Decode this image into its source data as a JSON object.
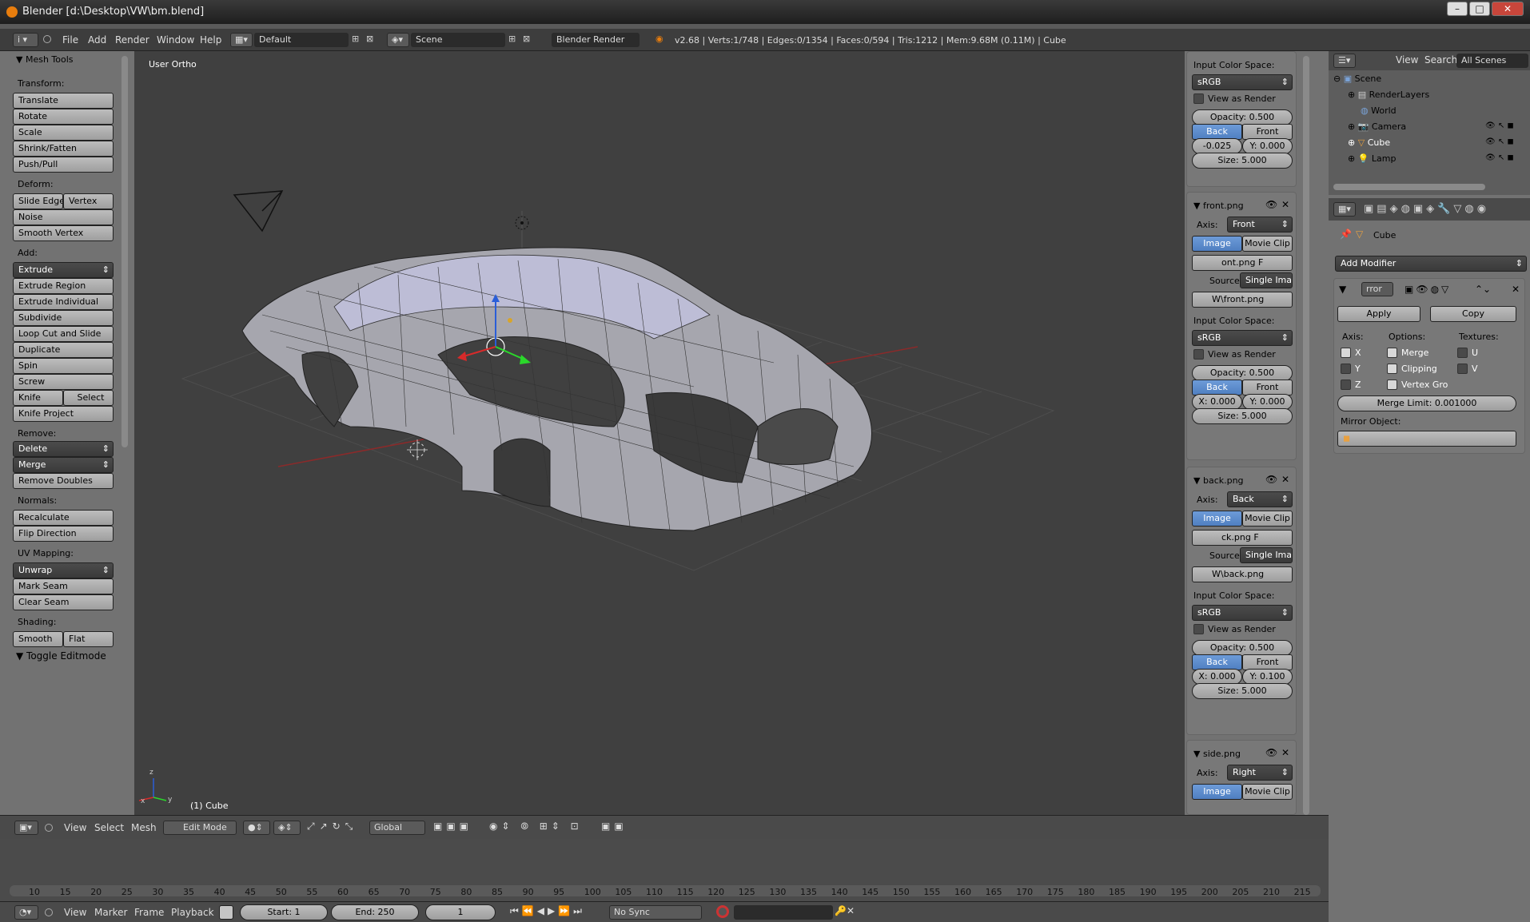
{
  "titlebar": {
    "title": "Blender [d:\\Desktop\\VW\\bm.blend]"
  },
  "infobar": {
    "menus": [
      "File",
      "Add",
      "Render",
      "Window",
      "Help"
    ],
    "layout": "Default",
    "scene": "Scene",
    "engine": "Blender Render",
    "stats": "v2.68 | Verts:1/748 | Edges:0/1354 | Faces:0/594 | Tris:1212 | Mem:9.68M (0.11M) | Cube"
  },
  "left": {
    "title": "Mesh Tools",
    "transform": {
      "label": "Transform:",
      "items": [
        "Translate",
        "Rotate",
        "Scale",
        "Shrink/Fatten",
        "Push/Pull"
      ]
    },
    "deform": {
      "label": "Deform:",
      "slide_edge": "Slide Edge",
      "vertex": "Vertex",
      "noise": "Noise",
      "smooth_vertex": "Smooth Vertex"
    },
    "add": {
      "label": "Add:",
      "extrude": "Extrude",
      "items": [
        "Extrude Region",
        "Extrude Individual",
        "Subdivide",
        "Loop Cut and Slide",
        "Duplicate",
        "Spin",
        "Screw"
      ],
      "knife": "Knife",
      "select": "Select",
      "knife_project": "Knife Project"
    },
    "remove": {
      "label": "Remove:",
      "delete": "Delete",
      "merge": "Merge",
      "remove_doubles": "Remove Doubles"
    },
    "normals": {
      "label": "Normals:",
      "recalculate": "Recalculate",
      "flip": "Flip Direction"
    },
    "uv": {
      "label": "UV Mapping:",
      "unwrap": "Unwrap",
      "mark_seam": "Mark Seam",
      "clear_seam": "Clear Seam"
    },
    "shading": {
      "label": "Shading:",
      "smooth": "Smooth",
      "flat": "Flat"
    },
    "toggle": "Toggle Editmode"
  },
  "view3d": {
    "label": "User Ortho",
    "object": "(1) Cube",
    "axes": {
      "x": "x",
      "y": "y",
      "z": "z"
    }
  },
  "props": {
    "top": {
      "ics_label": "Input Color Space:",
      "ics": "sRGB",
      "view_render": "View as Render",
      "opacity": "Opacity: 0.500",
      "back": "Back",
      "front": "Front",
      "x": "-0.025",
      "y": "Y: 0.000",
      "size": "Size: 5.000"
    },
    "panels": [
      {
        "name": "front.png",
        "axis_label": "Axis:",
        "axis": "Front",
        "image": "Image",
        "movie": "Movie Clip",
        "file": "ont.png",
        "f": "F",
        "source_label": "Source",
        "source": "Single Image",
        "path": "W\\front.png",
        "ics_label": "Input Color Space:",
        "ics": "sRGB",
        "view_render": "View as Render",
        "opacity": "Opacity: 0.500",
        "back": "Back",
        "front": "Front",
        "x": "X: 0.000",
        "y": "Y: 0.000",
        "size": "Size: 5.000"
      },
      {
        "name": "back.png",
        "axis_label": "Axis:",
        "axis": "Back",
        "image": "Image",
        "movie": "Movie Clip",
        "file": "ck.png",
        "f": "F",
        "source_label": "Source",
        "source": "Single Image",
        "path": "W\\back.png",
        "ics_label": "Input Color Space:",
        "ics": "sRGB",
        "view_render": "View as Render",
        "opacity": "Opacity: 0.500",
        "back": "Back",
        "front": "Front",
        "x": "X: 0.000",
        "y": "Y: 0.100",
        "size": "Size: 5.000"
      }
    ],
    "side": {
      "name": "side.png",
      "axis_label": "Axis:",
      "axis": "Right",
      "image": "Image",
      "movie": "Movie Clip"
    }
  },
  "outliner": {
    "view": "View",
    "search": "Search",
    "all_scenes": "All Scenes",
    "items": [
      "Scene",
      "RenderLayers",
      "World",
      "Camera",
      "Cube",
      "Lamp"
    ]
  },
  "modifier": {
    "object": "Cube",
    "add": "Add Modifier",
    "name": "rror",
    "apply": "Apply",
    "copy": "Copy",
    "axis_label": "Axis:",
    "options_label": "Options:",
    "textures_label": "Textures:",
    "x": "X",
    "y": "Y",
    "z": "Z",
    "merge": "Merge",
    "clipping": "Clipping",
    "vertex_groups": "Vertex Gro",
    "u": "U",
    "v": "V",
    "merge_limit": "Merge Limit: 0.001000",
    "mirror_object": "Mirror Object:"
  },
  "viewheader": {
    "view": "View",
    "select": "Select",
    "mesh": "Mesh",
    "mode": "Edit Mode",
    "orientation": "Global"
  },
  "timeline": {
    "ticks": [
      "10",
      "15",
      "20",
      "25",
      "30",
      "35",
      "40",
      "45",
      "50",
      "55",
      "60",
      "65",
      "70",
      "75",
      "80",
      "85",
      "90",
      "95",
      "100",
      "105",
      "110",
      "115",
      "120",
      "125",
      "130",
      "135",
      "140",
      "145",
      "150",
      "155",
      "160",
      "165",
      "170",
      "175",
      "180",
      "185",
      "190",
      "195",
      "200",
      "205",
      "210",
      "215"
    ]
  },
  "timeheader": {
    "view": "View",
    "marker": "Marker",
    "frame": "Frame",
    "playback": "Playback",
    "start": "Start: 1",
    "end": "End: 250",
    "current": "1",
    "sync": "No Sync"
  }
}
